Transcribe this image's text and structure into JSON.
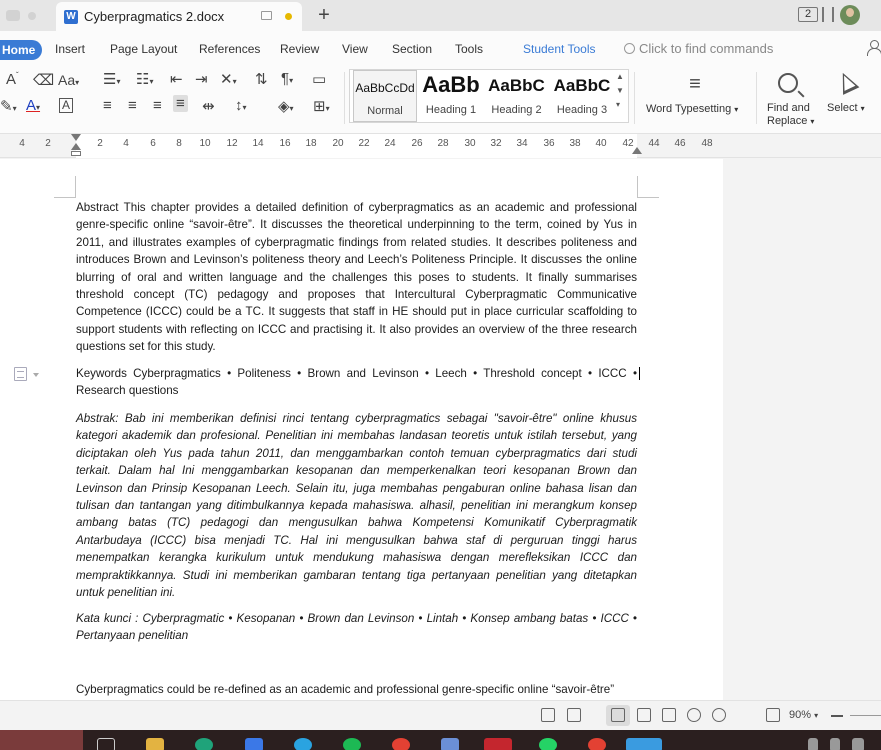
{
  "tab": {
    "title": "Cyberpragmatics 2.docx"
  },
  "titlebar": {
    "count_badge": "2"
  },
  "menu": {
    "home": "Home",
    "insert": "Insert",
    "page_layout": "Page Layout",
    "references": "References",
    "review": "Review",
    "view": "View",
    "section": "Section",
    "tools": "Tools",
    "student_tools": "Student Tools",
    "search_placeholder": "Click to find commands"
  },
  "ribbon": {
    "styles": [
      {
        "sample": "AaBbCcDd",
        "caption": "Normal"
      },
      {
        "sample": "AaBb",
        "caption": "Heading 1"
      },
      {
        "sample": "AaBbC",
        "caption": "Heading 2"
      },
      {
        "sample": "AaBbC",
        "caption": "Heading 3"
      }
    ],
    "word_typesetting": "Word Typesetting",
    "find_replace_1": "Find and",
    "find_replace_2": "Replace",
    "select": "Select"
  },
  "ruler": {
    "ticks": [
      "4",
      "2",
      "2",
      "4",
      "6",
      "8",
      "10",
      "12",
      "14",
      "16",
      "18",
      "20",
      "22",
      "24",
      "26",
      "28",
      "30",
      "32",
      "34",
      "36",
      "38",
      "40",
      "42",
      "44",
      "46",
      "48"
    ]
  },
  "document": {
    "abstract_en": "Abstract This chapter provides a detailed definition of cyberpragmatics as an academic and professional genre-specific online “savoir-être”. It discusses the theoretical underpinning to the term, coined by Yus in 2011, and illustrates examples of cyberpragmatic findings from related studies. It describes politeness and introduces Brown and Levinson’s politeness theory and Leech’s Politeness Principle. It discusses the online blurring of oral and written language and the challenges this poses to students. It finally summarises threshold concept (TC) pedagogy and proposes that Intercultural Cyberpragmatic Communicative Competence (ICCC) could be a TC. It suggests that staff in HE should put in place curricular scaffolding to support students with reflecting on ICCC and practising it. It also provides an overview of the three research questions set for this study.",
    "keywords_en": "Keywords Cyberpragmatics • Politeness • Brown and Levinson • Leech • Threshold concept • ICCC • Research questions",
    "abstract_id": "Abstrak: Bab ini memberikan definisi rinci tentang cyberpragmatics sebagai \"savoir-être\" online khusus kategori akademik dan profesional. Penelitian ini membahas landasan teoretis untuk istilah tersebut, yang diciptakan oleh Yus pada tahun 2011, dan menggambarkan contoh temuan cyberpragmatics dari studi terkait. Dalam hal Ini menggambarkan kesopanan dan memperkenalkan teori kesopanan Brown dan Levinson dan Prinsip Kesopanan Leech. Selain itu, juga membahas pengaburan online bahasa lisan dan tulisan dan tantangan yang ditimbulkannya kepada mahasiswa. alhasil, penelitian ini merangkum konsep ambang batas (TC) pedagogi dan mengusulkan bahwa Kompetensi Komunikatif Cyberpragmatik Antarbudaya (ICCC) bisa menjadi TC. Hal ini mengusulkan bahwa staf di perguruan tinggi harus menempatkan kerangka kurikulum untuk mendukung mahasiswa dengan merefleksikan ICCC dan mempraktikkannya. Studi ini memberikan gambaran tentang tiga pertanyaan penelitian yang ditetapkan untuk penelitian ini.",
    "keywords_id": "Kata kunci : Cyberpragmatic • Kesopanan • Brown dan Levinson • Lintah • Konsep ambang batas • ICCC • Pertanyaan penelitian",
    "body_start": "Cyberpragmatics could be re-defined as an academic and professional genre-specific online “savoir-être”"
  },
  "status": {
    "zoom": "90%"
  }
}
